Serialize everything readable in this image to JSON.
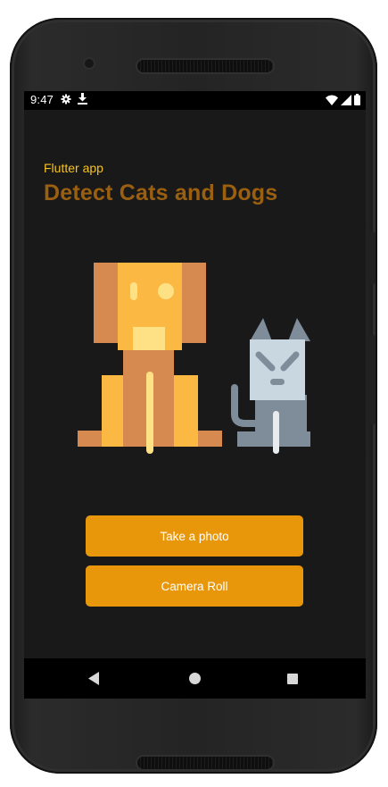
{
  "status_bar": {
    "time": "9:47",
    "left_icons": [
      "gear-icon",
      "download-icon"
    ],
    "right_icons": [
      "wifi-icon",
      "signal-icon",
      "battery-icon"
    ]
  },
  "app": {
    "subtitle": "Flutter app",
    "title": "Detect Cats and Dogs",
    "illustration": "dog-and-cat-illustration"
  },
  "buttons": {
    "take_photo": "Take a photo",
    "camera_roll": "Camera Roll"
  },
  "nav_bar": {
    "icons": [
      "back-icon",
      "home-icon",
      "recents-icon"
    ]
  },
  "colors": {
    "screen_background": "#191919",
    "subtitle": "#f6c323",
    "title": "#9b5f10",
    "button": "#e8960a",
    "button_text": "#ffffff"
  }
}
